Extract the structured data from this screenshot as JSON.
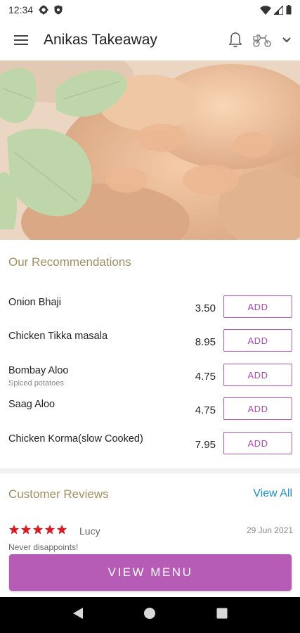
{
  "status_bar": {
    "time": "12:34"
  },
  "app_bar": {
    "title": "Anikas Takeaway"
  },
  "recommendations": {
    "title": "Our Recommendations",
    "add_label": "ADD",
    "items": [
      {
        "name": "Onion Bhaji",
        "description": "",
        "price": "3.50"
      },
      {
        "name": "Chicken Tikka masala",
        "description": "",
        "price": "8.95"
      },
      {
        "name": "Bombay Aloo",
        "description": "Spiced potatoes",
        "price": "4.75"
      },
      {
        "name": "Saag Aloo",
        "description": "",
        "price": "4.75"
      },
      {
        "name": "Chicken Korma(slow Cooked)",
        "description": "",
        "price": "7.95"
      }
    ]
  },
  "reviews": {
    "title": "Customer Reviews",
    "view_all_label": "View All",
    "items": [
      {
        "rating": 5,
        "reviewer": "Lucy",
        "date": "29 Jun 2021",
        "text": "Never disappoints!"
      }
    ]
  },
  "cta": {
    "label": "VIEW MENU"
  },
  "colors": {
    "accent": "#b65bb6",
    "link": "#1d8fc7",
    "section_title": "#a08f62",
    "star": "#d81f26"
  }
}
